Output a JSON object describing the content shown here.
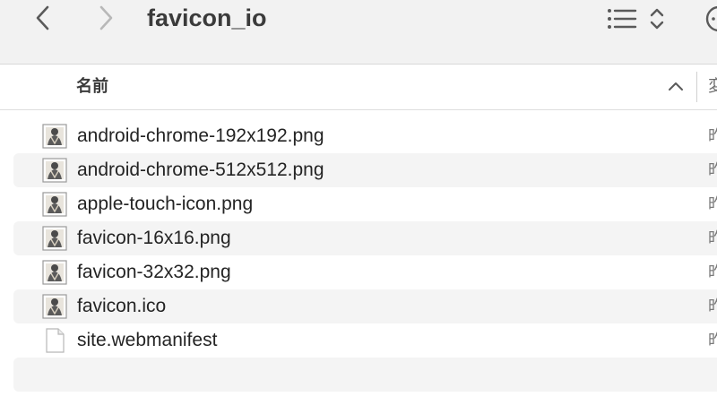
{
  "toolbar": {
    "title": "favicon_io",
    "back_icon": "chevron-left-icon",
    "forward_icon": "chevron-right-icon",
    "view_icon": "list-view-icon",
    "view_toggle_icon": "up-down-chevron-icon",
    "more_icon": "more-circle-icon"
  },
  "columns": {
    "name_label": "名前",
    "sort_direction": "ascending",
    "next_label": "変"
  },
  "files": [
    {
      "name": "android-chrome-192x192.png",
      "date": "昨",
      "icon": "image-thumbnail-icon"
    },
    {
      "name": "android-chrome-512x512.png",
      "date": "昨",
      "icon": "image-thumbnail-icon"
    },
    {
      "name": "apple-touch-icon.png",
      "date": "昨",
      "icon": "image-thumbnail-icon"
    },
    {
      "name": "favicon-16x16.png",
      "date": "昨",
      "icon": "image-thumbnail-icon"
    },
    {
      "name": "favicon-32x32.png",
      "date": "昨",
      "icon": "image-thumbnail-icon"
    },
    {
      "name": "favicon.ico",
      "date": "昨",
      "icon": "image-thumbnail-icon"
    },
    {
      "name": "site.webmanifest",
      "date": "昨",
      "icon": "document-icon"
    }
  ],
  "colors": {
    "toolbar_bg": "#f2f2f2",
    "row_alt_bg": "#f4f4f4",
    "text": "#242424"
  }
}
